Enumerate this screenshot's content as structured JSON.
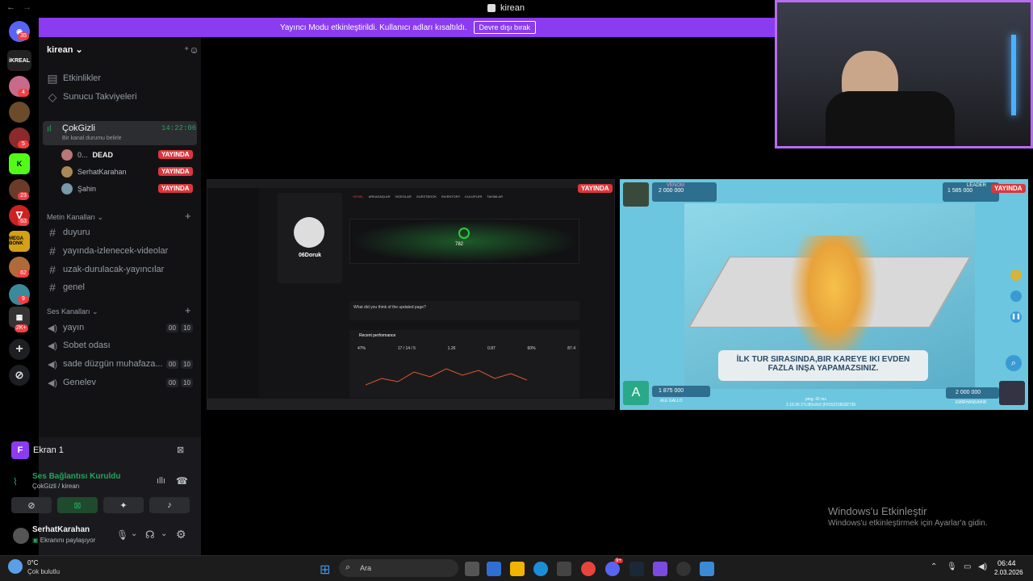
{
  "window": {
    "title": "kirean"
  },
  "banner": {
    "text": "Yayıncı Modu etkinleştirildi. Kullanıcı adları kısaltıldı.",
    "button": "Devre dışı bırak"
  },
  "servers": {
    "badges": [
      "35",
      "4",
      "5",
      "23",
      "63",
      "62",
      "9",
      "2K+"
    ]
  },
  "server_header": {
    "name": "kirean"
  },
  "nav": {
    "events": "Etkinlikler",
    "boosts": "Sunucu Takviyeleri"
  },
  "voice_active": {
    "name": "ÇokGizli",
    "timer": "14:22:06",
    "status_hint": "Bir kanal durumu belirle",
    "users": [
      {
        "name": "0...",
        "tag": "DEAD",
        "live": "YAYINDA"
      },
      {
        "name": "SerhatKarahan",
        "live": "YAYINDA"
      },
      {
        "name": "Şahin",
        "live": "YAYINDA"
      }
    ]
  },
  "text_category": {
    "label": "Metin Kanalları",
    "channels": [
      "duyuru",
      "yayında-izlenecek-videolar",
      "uzak-durulacak-yayıncılar",
      "genel"
    ]
  },
  "voice_category": {
    "label": "Ses Kanalları",
    "channels": [
      {
        "name": "yayın",
        "a": "00",
        "b": "10"
      },
      {
        "name": "Sobet odası"
      },
      {
        "name": "sade düzgün muhafaza...",
        "a": "00",
        "b": "10"
      },
      {
        "name": "Genelev",
        "a": "00",
        "b": "10"
      }
    ]
  },
  "screen_panel": {
    "title": "Ekran 1",
    "avatar_letter": "F"
  },
  "connection": {
    "status": "Ses Bağlantısı Kuruldu",
    "detail": "ÇokGizli / kirean"
  },
  "user": {
    "name": "SerhatKarahan",
    "status": "Ekranını paylaşıyor"
  },
  "tile1": {
    "live": "YAYINDA",
    "profile_name": "06Doruk",
    "nav_tabs": [
      "GENEL",
      "ARKADAŞLAR",
      "VIDEOLAR",
      "GUESTBOOK",
      "INVENTORY",
      "KULÜPLER",
      "TAKIMLAR"
    ],
    "elo": "782",
    "survey": "What did you think of the updated page?",
    "perf_title": "Recent performance",
    "stats": [
      "47%",
      "17 / 14 / 5",
      "1.26",
      "0.87",
      "60%",
      "87.4"
    ]
  },
  "tile2": {
    "live": "YAYINDA",
    "top_left_label": "VENOM",
    "top_left_money": "2 000 000",
    "top_right_label": "LEADER",
    "top_right_money": "1 585 000",
    "bottom_left_money": "1 875 000",
    "bottom_left_name": "ALE GALLO",
    "bottom_left_letter": "A",
    "bottom_right_money": "2 000 000",
    "bottom_right_name": "EMIRHANSAHIR",
    "banner_line1": "İLK TUR SIRASINDA,BIR KAREYE IKI EVDEN",
    "banner_line2": "FAZLA INŞA YAPAMAZSINIZ.",
    "ping": "ping: 42 ms",
    "build": "2.19.26 27c3f2e2c0 (F9152158182735"
  },
  "watermark": {
    "line1": "Windows'u Etkinleştir",
    "line2": "Windows'u etkinleştirmek için Ayarlar'a gidin."
  },
  "taskbar": {
    "weather_temp": "0°C",
    "weather_desc": "Çok bulutlu",
    "search": "Ara",
    "time": "06:44",
    "date": "2.03.2026",
    "discord_badge": "9+"
  },
  "colors": {
    "accent": "#8b3bf0",
    "live": "#da373c",
    "green": "#23a55a"
  }
}
